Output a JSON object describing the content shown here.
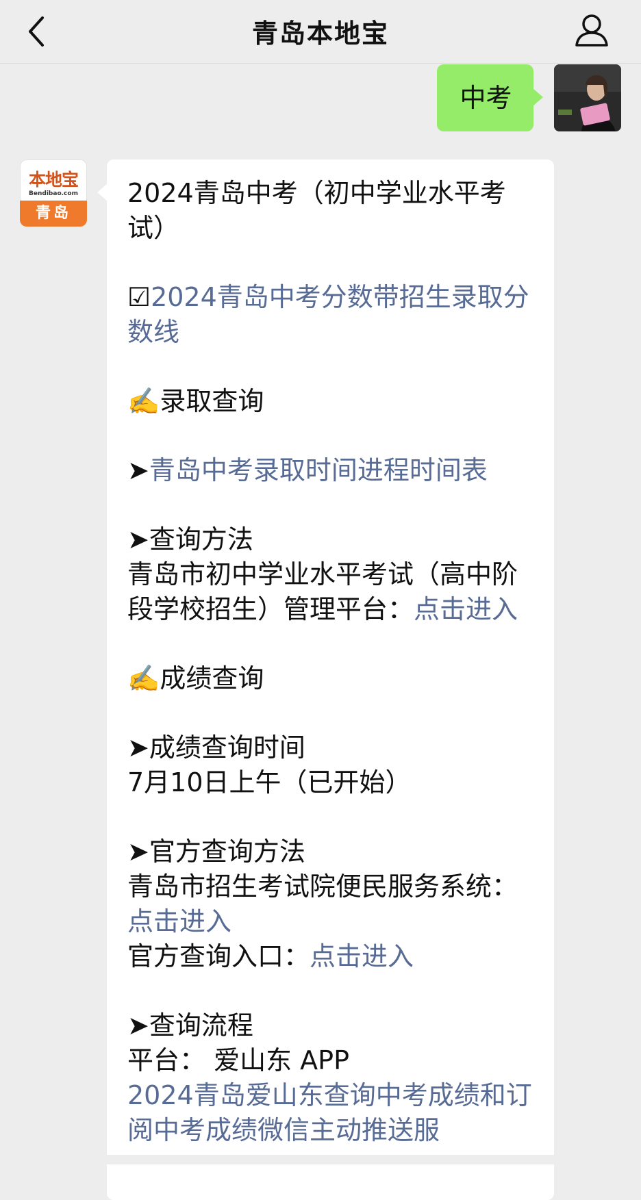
{
  "header": {
    "title": "青岛本地宝",
    "back_icon": "chevron-left-icon",
    "profile_icon": "user-icon"
  },
  "outgoing": {
    "text": "中考"
  },
  "bot_avatar": {
    "brand": "本地宝",
    "site": "Bendibao.com",
    "city": "青岛"
  },
  "message": {
    "title": "2024青岛中考（初中学业水平考试）",
    "checkbox_symbol": "☑",
    "link_score": "2024青岛中考分数带招生录取分数线",
    "writing_symbol_1": "✍️",
    "section_admission": "录取查询",
    "arrow": "➤",
    "link_admission_schedule": "青岛中考录取时间进程时间表",
    "query_method_heading": "查询方法",
    "query_method_text": "青岛市初中学业水平考试（高中阶段学校招生）管理平台：",
    "link_enter_1": "点击进入",
    "writing_symbol_2": "✍️",
    "section_scores": "成绩查询",
    "score_time_heading": "成绩查询时间",
    "score_time_text": "7月10日上午（已开始）",
    "official_method_heading": "官方查询方法",
    "official_method_text": "青岛市招生考试院便民服务系统：",
    "link_enter_2": "点击进入",
    "official_entry_text": "官方查询入口：",
    "link_enter_3": "点击进入",
    "process_heading": "查询流程",
    "platform_text": "平台： 爱山东 APP",
    "link_aishandong": "2024青岛爱山东查询中考成绩和订阅中考成绩微信主动推送服"
  },
  "colors": {
    "link": "#576b95",
    "bubble_out": "#95ec69",
    "background": "#ededed"
  }
}
